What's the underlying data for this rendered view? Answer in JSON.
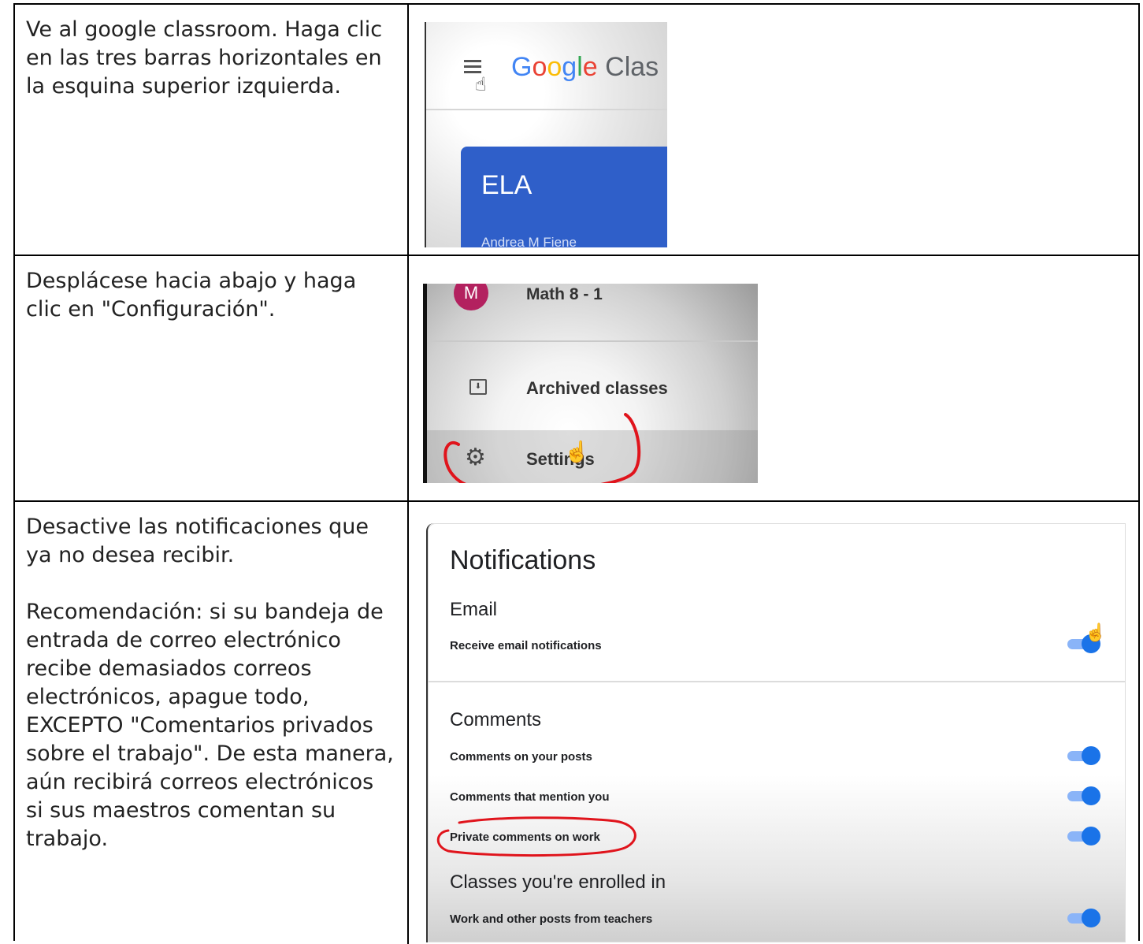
{
  "steps": [
    {
      "instruction": "Ve al google classroom. Haga clic en las tres barras horizontales en la esquina superior izquierda."
    },
    {
      "instruction": "Desplácese hacia abajo y haga clic en \"Configuración\"."
    },
    {
      "instruction": "Desactive las notificaciones que ya no desea recibir.",
      "note": "Recomendación: si su bandeja de entrada de correo electrónico recibe demasiados correos electrónicos, apague todo, EXCEPTO \"Comentarios privados sobre el trabajo\". De esta manera, aún recibirá correos electrónicos si sus maestros comentan su trabajo."
    }
  ],
  "screenshot1": {
    "logo_text": "Google Clas",
    "class_name": "ELA",
    "teacher": "Andrea M Fiene",
    "icons": [
      "menu-icon",
      "pointer-hand-icon"
    ]
  },
  "screenshot2": {
    "avatar_letter": "M",
    "class_item": "Math 8 - 1",
    "archived": "Archived classes",
    "settings": "Settings",
    "icons": [
      "archive-icon",
      "gear-icon",
      "pointer-hand-icon"
    ]
  },
  "screenshot3": {
    "title": "Notifications",
    "email_section": "Email",
    "email_toggle": "Receive email notifications",
    "comments_section": "Comments",
    "comments": [
      "Comments on your posts",
      "Comments that mention you",
      "Private comments on work"
    ],
    "classes_section": "Classes you're enrolled in",
    "classes_toggle": "Work and other posts from teachers",
    "toggle_on_color": "#1a73e8",
    "highlight_color": "#e0141c"
  }
}
